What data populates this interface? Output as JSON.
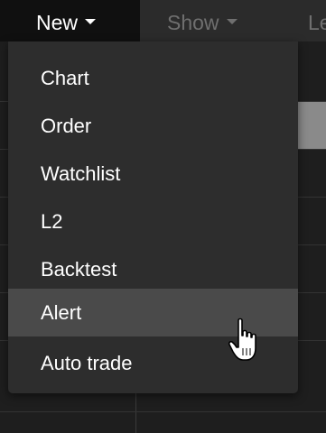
{
  "menubar": {
    "items": [
      {
        "label": "New",
        "active": true
      },
      {
        "label": "Show",
        "active": false
      },
      {
        "label": "Le",
        "active": false
      }
    ]
  },
  "dropdown": {
    "items": [
      {
        "label": "Chart"
      },
      {
        "label": "Order"
      },
      {
        "label": "Watchlist"
      },
      {
        "label": "L2"
      },
      {
        "label": "Backtest"
      },
      {
        "label": "Alert",
        "hovered": true
      },
      {
        "label": "Auto trade"
      }
    ]
  },
  "cursor": {
    "type": "hand-pointer-icon"
  },
  "colors": {
    "menubar_bg": "#2b2b2b",
    "active_menu_bg": "#101010",
    "dropdown_bg": "#2d2d2d",
    "hover_bg": "#4a4a4a",
    "text": "#ffffff",
    "muted_text": "#6f6f6f"
  }
}
